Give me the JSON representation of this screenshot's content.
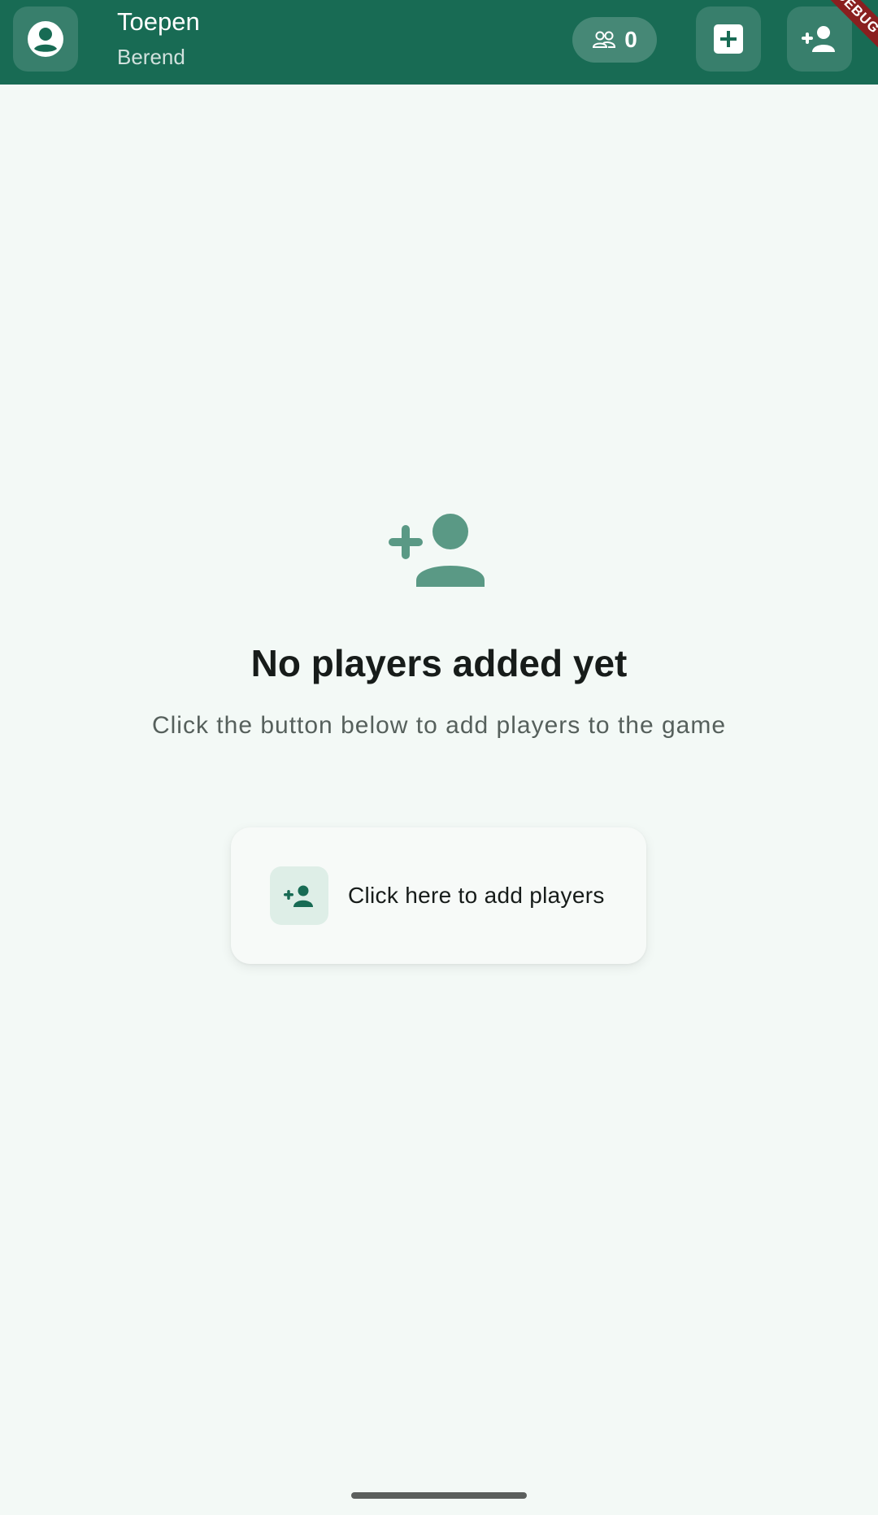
{
  "app_bar": {
    "title": "Toepen",
    "subtitle": "Berend",
    "player_count": "0",
    "debug_banner": "DEBUG"
  },
  "empty_state": {
    "title": "No players added yet",
    "subtitle": "Click the button below to add players to the game",
    "add_button_label": "Click here to add players"
  },
  "icons": {
    "avatar": "account-circle-icon",
    "players": "group-icon",
    "add": "add-box-icon",
    "add_player": "person-add-icon"
  },
  "colors": {
    "primary": "#186b54",
    "background": "#f3f9f6",
    "accent_soft": "#5a9985",
    "card_icon_bg": "#deeee7",
    "debug": "#8a1f1f"
  }
}
